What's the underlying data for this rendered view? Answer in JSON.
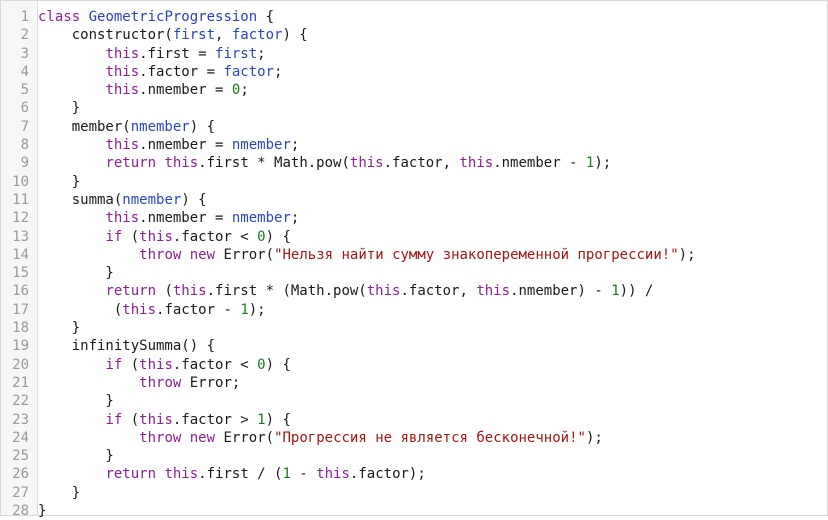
{
  "editor": {
    "lines": [
      {
        "n": "1",
        "tokens": [
          [
            "kw",
            "class"
          ],
          [
            "txt",
            " "
          ],
          [
            "cls",
            "GeometricProgression"
          ],
          [
            "txt",
            " {"
          ]
        ]
      },
      {
        "n": "2",
        "tokens": [
          [
            "txt",
            "    constructor("
          ],
          [
            "var",
            "first"
          ],
          [
            "txt",
            ", "
          ],
          [
            "var",
            "factor"
          ],
          [
            "txt",
            ") {"
          ]
        ]
      },
      {
        "n": "3",
        "tokens": [
          [
            "txt",
            "        "
          ],
          [
            "kw",
            "this"
          ],
          [
            "txt",
            ".first = "
          ],
          [
            "var",
            "first"
          ],
          [
            "txt",
            ";"
          ]
        ]
      },
      {
        "n": "4",
        "tokens": [
          [
            "txt",
            "        "
          ],
          [
            "kw",
            "this"
          ],
          [
            "txt",
            ".factor = "
          ],
          [
            "var",
            "factor"
          ],
          [
            "txt",
            ";"
          ]
        ]
      },
      {
        "n": "5",
        "tokens": [
          [
            "txt",
            "        "
          ],
          [
            "kw",
            "this"
          ],
          [
            "txt",
            ".nmember = "
          ],
          [
            "num",
            "0"
          ],
          [
            "txt",
            ";"
          ]
        ]
      },
      {
        "n": "6",
        "tokens": [
          [
            "txt",
            "    }"
          ]
        ]
      },
      {
        "n": "7",
        "tokens": [
          [
            "txt",
            "    member("
          ],
          [
            "var",
            "nmember"
          ],
          [
            "txt",
            ") {"
          ]
        ]
      },
      {
        "n": "8",
        "tokens": [
          [
            "txt",
            "        "
          ],
          [
            "kw",
            "this"
          ],
          [
            "txt",
            ".nmember = "
          ],
          [
            "var",
            "nmember"
          ],
          [
            "txt",
            ";"
          ]
        ]
      },
      {
        "n": "9",
        "tokens": [
          [
            "txt",
            "        "
          ],
          [
            "kw",
            "return"
          ],
          [
            "txt",
            " "
          ],
          [
            "kw",
            "this"
          ],
          [
            "txt",
            ".first * Math.pow("
          ],
          [
            "kw",
            "this"
          ],
          [
            "txt",
            ".factor, "
          ],
          [
            "kw",
            "this"
          ],
          [
            "txt",
            ".nmember - "
          ],
          [
            "num",
            "1"
          ],
          [
            "txt",
            ");"
          ]
        ]
      },
      {
        "n": "10",
        "tokens": [
          [
            "txt",
            "    }"
          ]
        ]
      },
      {
        "n": "11",
        "tokens": [
          [
            "txt",
            "    summa("
          ],
          [
            "var",
            "nmember"
          ],
          [
            "txt",
            ") {"
          ]
        ]
      },
      {
        "n": "12",
        "tokens": [
          [
            "txt",
            "        "
          ],
          [
            "kw",
            "this"
          ],
          [
            "txt",
            ".nmember = "
          ],
          [
            "var",
            "nmember"
          ],
          [
            "txt",
            ";"
          ]
        ]
      },
      {
        "n": "13",
        "tokens": [
          [
            "txt",
            "        "
          ],
          [
            "kw",
            "if"
          ],
          [
            "txt",
            " ("
          ],
          [
            "kw",
            "this"
          ],
          [
            "txt",
            ".factor < "
          ],
          [
            "num",
            "0"
          ],
          [
            "txt",
            ") {"
          ]
        ]
      },
      {
        "n": "14",
        "tokens": [
          [
            "txt",
            "            "
          ],
          [
            "kw",
            "throw"
          ],
          [
            "txt",
            " "
          ],
          [
            "kw",
            "new"
          ],
          [
            "txt",
            " Error("
          ],
          [
            "str",
            "\"Нельзя найти сумму знакопеременной прогрессии!\""
          ],
          [
            "txt",
            ");"
          ]
        ]
      },
      {
        "n": "15",
        "tokens": [
          [
            "txt",
            "        }"
          ]
        ]
      },
      {
        "n": "16",
        "tokens": [
          [
            "txt",
            "        "
          ],
          [
            "kw",
            "return"
          ],
          [
            "txt",
            " ("
          ],
          [
            "kw",
            "this"
          ],
          [
            "txt",
            ".first * (Math.pow("
          ],
          [
            "kw",
            "this"
          ],
          [
            "txt",
            ".factor, "
          ],
          [
            "kw",
            "this"
          ],
          [
            "txt",
            ".nmember) - "
          ],
          [
            "num",
            "1"
          ],
          [
            "txt",
            ")) /"
          ]
        ]
      },
      {
        "n": "17",
        "tokens": [
          [
            "txt",
            "         ("
          ],
          [
            "kw",
            "this"
          ],
          [
            "txt",
            ".factor - "
          ],
          [
            "num",
            "1"
          ],
          [
            "txt",
            ");"
          ]
        ]
      },
      {
        "n": "18",
        "tokens": [
          [
            "txt",
            "    }"
          ]
        ]
      },
      {
        "n": "19",
        "tokens": [
          [
            "txt",
            "    infinitySumma() {"
          ]
        ]
      },
      {
        "n": "20",
        "tokens": [
          [
            "txt",
            "        "
          ],
          [
            "kw",
            "if"
          ],
          [
            "txt",
            " ("
          ],
          [
            "kw",
            "this"
          ],
          [
            "txt",
            ".factor < "
          ],
          [
            "num",
            "0"
          ],
          [
            "txt",
            ") {"
          ]
        ]
      },
      {
        "n": "21",
        "tokens": [
          [
            "txt",
            "            "
          ],
          [
            "kw",
            "throw"
          ],
          [
            "txt",
            " Error;"
          ]
        ]
      },
      {
        "n": "22",
        "tokens": [
          [
            "txt",
            "        }"
          ]
        ]
      },
      {
        "n": "23",
        "tokens": [
          [
            "txt",
            "        "
          ],
          [
            "kw",
            "if"
          ],
          [
            "txt",
            " ("
          ],
          [
            "kw",
            "this"
          ],
          [
            "txt",
            ".factor > "
          ],
          [
            "num",
            "1"
          ],
          [
            "txt",
            ") {"
          ]
        ]
      },
      {
        "n": "24",
        "tokens": [
          [
            "txt",
            "            "
          ],
          [
            "kw",
            "throw"
          ],
          [
            "txt",
            " "
          ],
          [
            "kw",
            "new"
          ],
          [
            "txt",
            " Error("
          ],
          [
            "str",
            "\"Прогрессия не является бесконечной!\""
          ],
          [
            "txt",
            ");"
          ]
        ]
      },
      {
        "n": "25",
        "tokens": [
          [
            "txt",
            "        }"
          ]
        ]
      },
      {
        "n": "26",
        "tokens": [
          [
            "txt",
            "        "
          ],
          [
            "kw",
            "return"
          ],
          [
            "txt",
            " "
          ],
          [
            "kw",
            "this"
          ],
          [
            "txt",
            ".first / ("
          ],
          [
            "num",
            "1"
          ],
          [
            "txt",
            " - "
          ],
          [
            "kw",
            "this"
          ],
          [
            "txt",
            ".factor);"
          ]
        ]
      },
      {
        "n": "27",
        "tokens": [
          [
            "txt",
            "    }"
          ]
        ]
      },
      {
        "n": "28",
        "tokens": [
          [
            "txt",
            "}"
          ]
        ]
      }
    ]
  }
}
